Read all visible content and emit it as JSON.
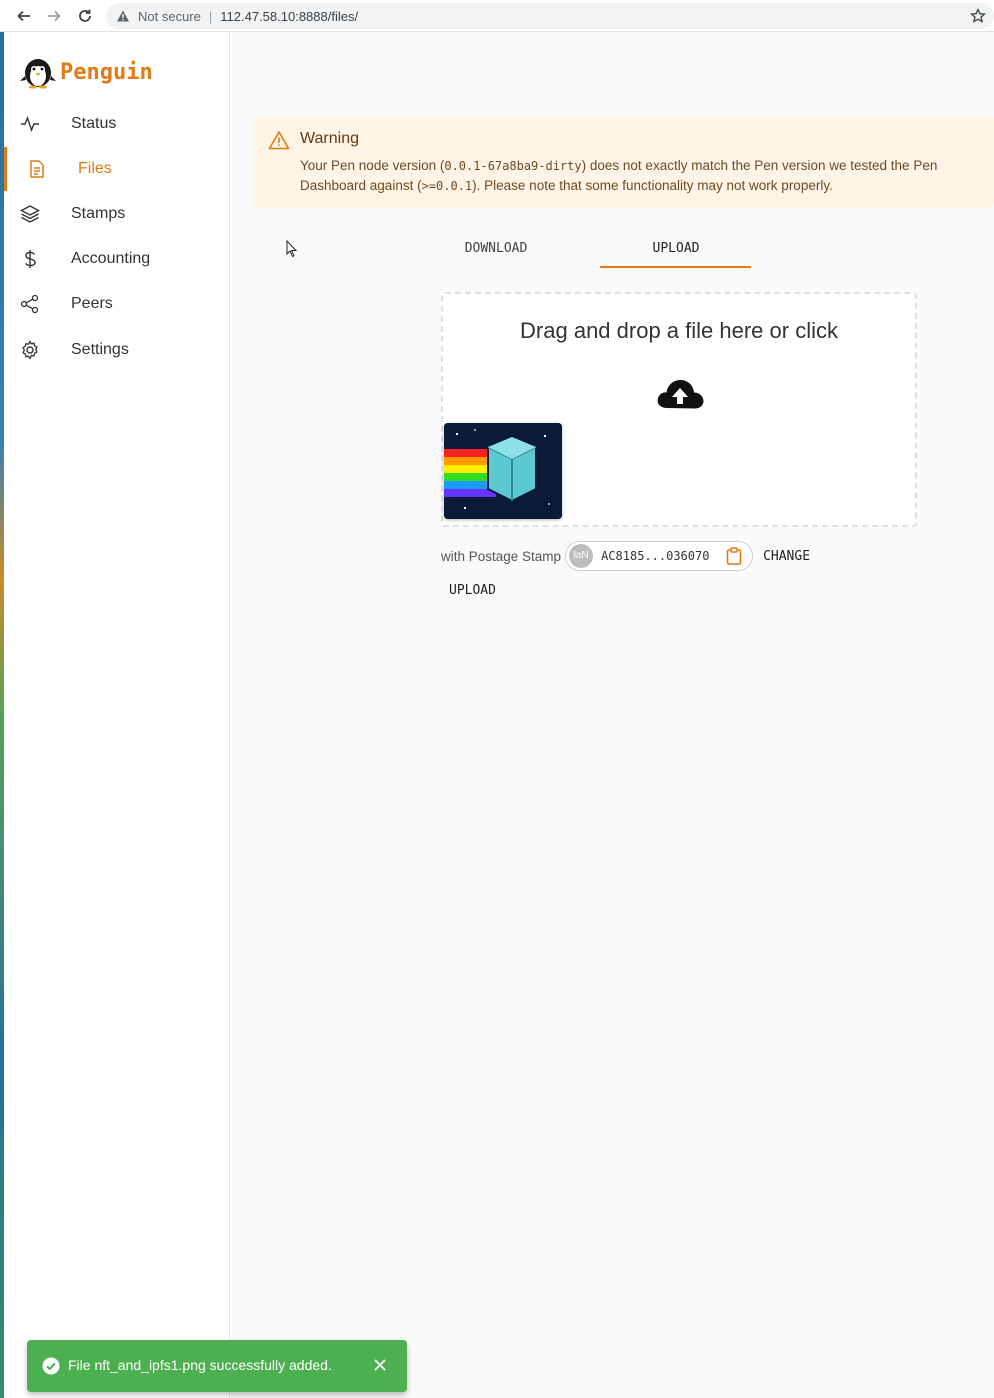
{
  "browser": {
    "security_label": "Not secure",
    "separator": "|",
    "url": "112.47.58.10:8888/files/"
  },
  "sidebar": {
    "brand": "Penguin",
    "items": [
      {
        "label": "Status",
        "icon": "activity-icon"
      },
      {
        "label": "Files",
        "icon": "file-icon",
        "active": true
      },
      {
        "label": "Stamps",
        "icon": "layers-icon"
      },
      {
        "label": "Accounting",
        "icon": "dollar-icon"
      },
      {
        "label": "Peers",
        "icon": "share-icon"
      },
      {
        "label": "Settings",
        "icon": "gear-icon"
      }
    ]
  },
  "warning": {
    "title": "Warning",
    "msg_1": "Your Pen node version (",
    "node_version": "0.0.1-67a8ba9-dirty",
    "msg_2": ") does not exactly match the Pen version we tested the Pen Dashboard against (",
    "tested_version": ">=0.0.1",
    "msg_3": "). Please note that some functionality may not work properly."
  },
  "tabs": {
    "download": "DOWNLOAD",
    "upload": "UPLOAD",
    "active": "upload"
  },
  "dropzone": {
    "text": "Drag and drop a file here or click"
  },
  "postage": {
    "label": "with Postage Stamp",
    "avatar": "laN",
    "stamp_id": "AC8185...036070",
    "change_label": "CHANGE"
  },
  "upload_label": "UPLOAD",
  "snackbar": {
    "message": "File nft_and_ipfs1.png successfully added."
  },
  "colors": {
    "accent": "#e07b16",
    "warning_bg": "#fff4e5",
    "success": "#4caf50"
  }
}
